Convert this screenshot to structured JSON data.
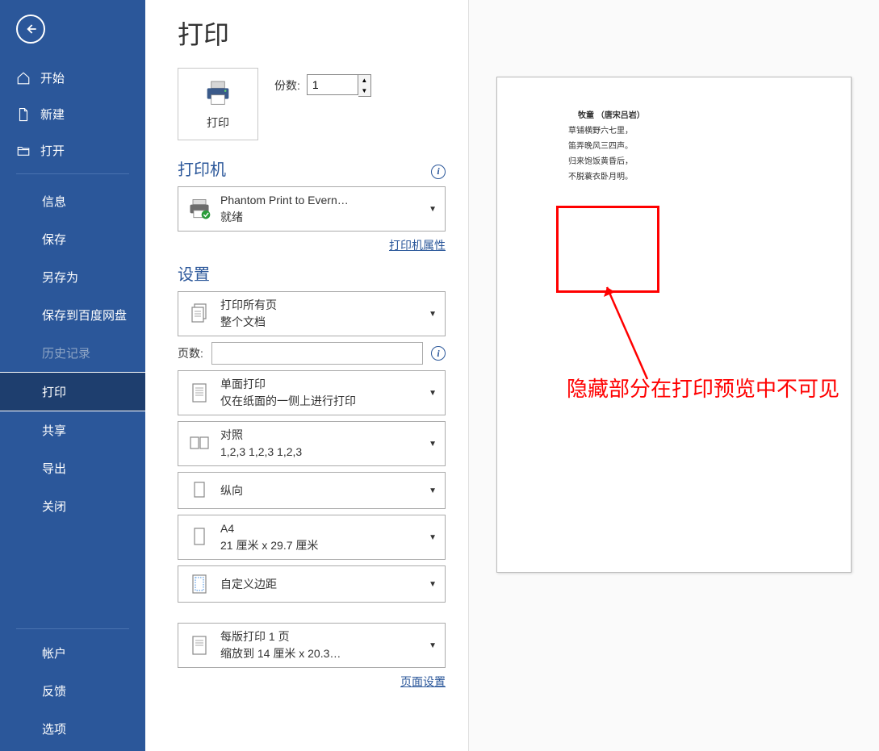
{
  "page_title": "打印",
  "sidebar": {
    "nav": [
      {
        "icon": "home",
        "label": "开始"
      },
      {
        "icon": "file",
        "label": "新建"
      },
      {
        "icon": "folder",
        "label": "打开"
      }
    ],
    "sub": [
      "信息",
      "保存",
      "另存为",
      "保存到百度网盘",
      "历史记录",
      "打印",
      "共享",
      "导出",
      "关闭"
    ],
    "footer": [
      "帐户",
      "反馈",
      "选项"
    ]
  },
  "print_button_label": "打印",
  "copies_label": "份数:",
  "copies_value": "1",
  "printer_section_title": "打印机",
  "printer": {
    "name": "Phantom Print to Evern…",
    "status": "就绪"
  },
  "printer_properties_link": "打印机属性",
  "settings_section_title": "设置",
  "settings": {
    "pages_option": {
      "title": "打印所有页",
      "sub": "整个文档"
    },
    "pages_label": "页数:",
    "pages_value": "",
    "sided": {
      "title": "单面打印",
      "sub": "仅在纸面的一侧上进行打印"
    },
    "collate": {
      "title": "对照",
      "sub": "1,2,3    1,2,3    1,2,3"
    },
    "orientation": {
      "title": "纵向"
    },
    "paper": {
      "title": "A4",
      "sub": "21 厘米 x 29.7 厘米"
    },
    "margins": {
      "title": "自定义边距"
    },
    "sheets": {
      "title": "每版打印 1 页",
      "sub": "缩放到 14 厘米 x 20.3…"
    }
  },
  "page_setup_link": "页面设置",
  "preview_doc": {
    "title": "牧童   （唐宋吕岩）",
    "lines": [
      "草铺横野六七里，",
      "笛弄晚风三四声。",
      "归来饱饭黄昏后，",
      "不脱蓑衣卧月明。"
    ]
  },
  "annotation_text": "隐藏部分在打印预览中不可见"
}
